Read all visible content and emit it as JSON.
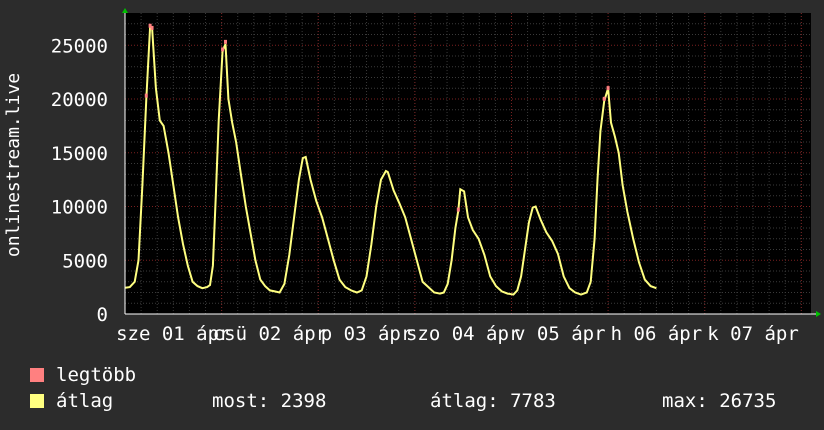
{
  "chart_data": {
    "type": "line",
    "ylabel": "onlinestream.live",
    "ylim": [
      0,
      28000
    ],
    "yticks": [
      0,
      5000,
      10000,
      15000,
      20000,
      25000
    ],
    "xlim": [
      0,
      7.1
    ],
    "day_ticks": [
      {
        "x": 0.5,
        "label": "sze 01 ápr"
      },
      {
        "x": 1.5,
        "label": "csü 02 ápr"
      },
      {
        "x": 2.5,
        "label": "p 03 ápr"
      },
      {
        "x": 3.5,
        "label": "szo 04 ápr"
      },
      {
        "x": 4.5,
        "label": "v 05 ápr"
      },
      {
        "x": 5.5,
        "label": "h 06 ápr"
      },
      {
        "x": 6.5,
        "label": "k 07 ápr"
      }
    ],
    "grid": true,
    "series": [
      {
        "name": "átlag",
        "color": "#ffff80",
        "points": [
          [
            0.0,
            2450
          ],
          [
            0.05,
            2500
          ],
          [
            0.1,
            3000
          ],
          [
            0.14,
            5000
          ],
          [
            0.18,
            12000
          ],
          [
            0.22,
            20000
          ],
          [
            0.26,
            26700
          ],
          [
            0.28,
            26600
          ],
          [
            0.32,
            21000
          ],
          [
            0.36,
            18000
          ],
          [
            0.4,
            17500
          ],
          [
            0.45,
            15000
          ],
          [
            0.5,
            12000
          ],
          [
            0.55,
            9000
          ],
          [
            0.6,
            6500
          ],
          [
            0.65,
            4500
          ],
          [
            0.7,
            3000
          ],
          [
            0.75,
            2600
          ],
          [
            0.8,
            2400
          ],
          [
            0.85,
            2500
          ],
          [
            0.88,
            2700
          ],
          [
            0.91,
            4500
          ],
          [
            0.94,
            11000
          ],
          [
            0.97,
            18000
          ],
          [
            1.01,
            24500
          ],
          [
            1.04,
            25100
          ],
          [
            1.07,
            20000
          ],
          [
            1.11,
            17800
          ],
          [
            1.15,
            16000
          ],
          [
            1.2,
            13000
          ],
          [
            1.25,
            10000
          ],
          [
            1.3,
            7500
          ],
          [
            1.35,
            5000
          ],
          [
            1.4,
            3200
          ],
          [
            1.45,
            2600
          ],
          [
            1.5,
            2200
          ],
          [
            1.55,
            2100
          ],
          [
            1.6,
            2000
          ],
          [
            1.65,
            2800
          ],
          [
            1.7,
            5500
          ],
          [
            1.75,
            9000
          ],
          [
            1.8,
            12500
          ],
          [
            1.84,
            14500
          ],
          [
            1.87,
            14600
          ],
          [
            1.92,
            12500
          ],
          [
            1.98,
            10500
          ],
          [
            2.04,
            9000
          ],
          [
            2.1,
            7000
          ],
          [
            2.16,
            5000
          ],
          [
            2.22,
            3200
          ],
          [
            2.28,
            2500
          ],
          [
            2.34,
            2200
          ],
          [
            2.4,
            2000
          ],
          [
            2.45,
            2200
          ],
          [
            2.5,
            3500
          ],
          [
            2.55,
            6500
          ],
          [
            2.6,
            10000
          ],
          [
            2.65,
            12500
          ],
          [
            2.7,
            13300
          ],
          [
            2.72,
            13200
          ],
          [
            2.78,
            11500
          ],
          [
            2.84,
            10300
          ],
          [
            2.9,
            9000
          ],
          [
            2.96,
            7000
          ],
          [
            3.02,
            5000
          ],
          [
            3.08,
            3000
          ],
          [
            3.14,
            2500
          ],
          [
            3.2,
            2000
          ],
          [
            3.26,
            1900
          ],
          [
            3.3,
            2000
          ],
          [
            3.34,
            2800
          ],
          [
            3.38,
            5000
          ],
          [
            3.42,
            8000
          ],
          [
            3.45,
            9600
          ],
          [
            3.47,
            11600
          ],
          [
            3.51,
            11400
          ],
          [
            3.55,
            9000
          ],
          [
            3.6,
            7800
          ],
          [
            3.66,
            7000
          ],
          [
            3.72,
            5500
          ],
          [
            3.78,
            3500
          ],
          [
            3.84,
            2600
          ],
          [
            3.9,
            2100
          ],
          [
            3.96,
            1900
          ],
          [
            4.02,
            1800
          ],
          [
            4.06,
            2200
          ],
          [
            4.1,
            3500
          ],
          [
            4.14,
            6000
          ],
          [
            4.18,
            8500
          ],
          [
            4.22,
            9900
          ],
          [
            4.25,
            10000
          ],
          [
            4.3,
            8800
          ],
          [
            4.36,
            7600
          ],
          [
            4.42,
            6800
          ],
          [
            4.48,
            5600
          ],
          [
            4.54,
            3500
          ],
          [
            4.6,
            2400
          ],
          [
            4.66,
            2000
          ],
          [
            4.72,
            1800
          ],
          [
            4.78,
            2000
          ],
          [
            4.82,
            3000
          ],
          [
            4.86,
            7000
          ],
          [
            4.89,
            12500
          ],
          [
            4.92,
            17000
          ],
          [
            4.96,
            19800
          ],
          [
            5.0,
            21000
          ],
          [
            5.03,
            17800
          ],
          [
            5.07,
            16500
          ],
          [
            5.11,
            15000
          ],
          [
            5.15,
            12000
          ],
          [
            5.2,
            9500
          ],
          [
            5.26,
            7000
          ],
          [
            5.32,
            4800
          ],
          [
            5.38,
            3200
          ],
          [
            5.44,
            2600
          ],
          [
            5.5,
            2400
          ]
        ]
      },
      {
        "name": "legtöbb",
        "color": "#ff8080",
        "points": [
          [
            0.22,
            20500
          ],
          [
            0.26,
            27000
          ],
          [
            0.28,
            26800
          ],
          [
            1.01,
            24800
          ],
          [
            1.04,
            25500
          ],
          [
            3.45,
            9900
          ],
          [
            4.96,
            20200
          ],
          [
            5.0,
            21200
          ]
        ]
      }
    ]
  },
  "legend": [
    {
      "label": "legtöbb",
      "color": "#ff8080"
    },
    {
      "label": "átlag",
      "color": "#ffff80"
    }
  ],
  "stats": {
    "most": "most: 2398",
    "avg": "átlag: 7783",
    "max": "max: 26735"
  },
  "colors": {
    "background": "#2c2c2c",
    "plot_background": "#000000",
    "axis": "#ffffff",
    "arrow": "#00c000"
  }
}
